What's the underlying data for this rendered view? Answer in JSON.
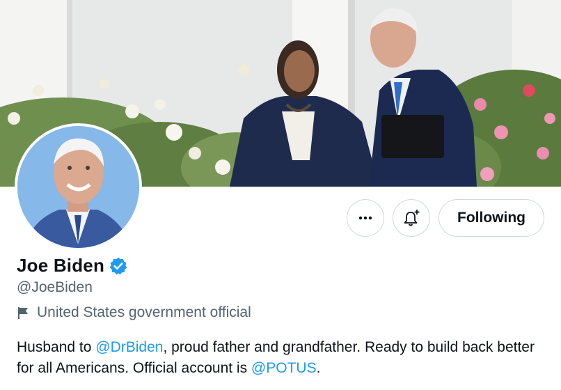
{
  "profile": {
    "display_name": "Joe Biden",
    "handle": "@JoeBiden",
    "verified_badge_icon": "verified-badge-icon",
    "category_icon": "flag-icon",
    "category": "United States government official",
    "bio": {
      "part1": "Husband to ",
      "mention1": "@DrBiden",
      "part2": ", proud father and grandfather. Ready to build back better for all Americans. Official account is ",
      "mention2": "@POTUS",
      "part3": "."
    }
  },
  "actions": {
    "more_icon": "more-options-icon",
    "notify_icon": "bell-plus-icon",
    "following_label": "Following"
  },
  "colors": {
    "accent": "#1d9bf0",
    "secondary_text": "#536471",
    "border": "#cfd9de"
  }
}
